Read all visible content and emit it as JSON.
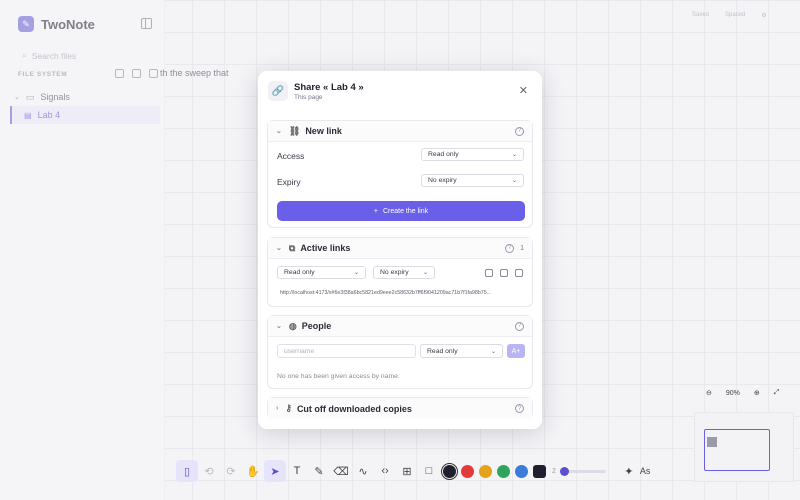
{
  "app": {
    "name": "TwoNote"
  },
  "sidebar": {
    "search_placeholder": "Search files",
    "file_system_label": "FILE SYSTEM",
    "tree": [
      {
        "label": "Signals"
      },
      {
        "label": "Lab 4"
      }
    ]
  },
  "document": {
    "text": "th the sweep that"
  },
  "top_right": {
    "saved": "Saved",
    "second": "Spaced"
  },
  "modal": {
    "title": "Share « Lab 4 »",
    "subtitle": "This page",
    "new_link": {
      "header": "New link",
      "access_label": "Access",
      "access_value": "Read only",
      "expiry_label": "Expiry",
      "expiry_value": "No expiry",
      "create_button": "Create the link"
    },
    "active_links": {
      "header": "Active links",
      "count": "1",
      "access_value": "Read only",
      "expiry_value": "No expiry",
      "url": "http://localhost:4173/s#6e3f38a6bc5821ed9eee2c58632b7ff6f9041209ac71b7f1fa98b75..."
    },
    "people": {
      "header": "People",
      "username_placeholder": "username",
      "access_value": "Read only",
      "empty_note": "No one has been given access by name."
    },
    "cutoff": {
      "header": "Cut off downloaded copies"
    }
  },
  "toolbar": {
    "colors": [
      "#1f1f2e",
      "#e23a3a",
      "#e3a21a",
      "#2da55a",
      "#3a7bdc",
      "#1f1f2e"
    ],
    "stroke_label": "2",
    "text_size_label": "As"
  },
  "zoom": {
    "level": "90%"
  }
}
